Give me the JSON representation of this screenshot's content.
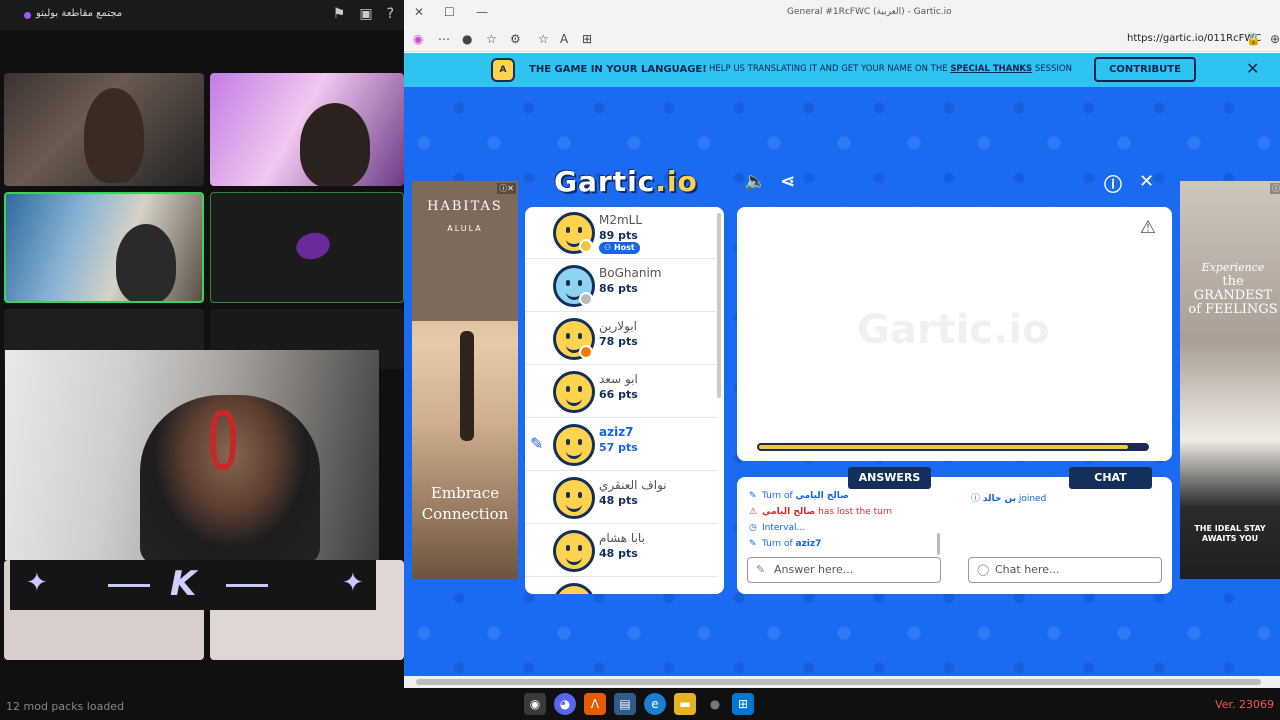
{
  "left_panel": {
    "room_title": "مجتمع مقاطعة بوليتو",
    "toolbar_icons": [
      "flag-icon",
      "screen-share-icon",
      "help-icon"
    ],
    "overlay_logo": "K",
    "mod_status": "12 mod packs loaded"
  },
  "browser": {
    "tab_title": "General #1RcFWC (العربية) - Gartic.io",
    "url": "https://gartic.io/011RcFWC"
  },
  "banner": {
    "badge": "A",
    "headline": "THE GAME IN YOUR LANGUAGE!",
    "text_before": "HELP US TRANSLATING IT AND GET YOUR NAME ON THE",
    "link_text": "SPECIAL THANKS",
    "text_after": "SESSION",
    "contribute_label": "CONTRIBUTE",
    "close_label": "✕"
  },
  "ads": {
    "left": {
      "brand": "HABITAS",
      "sub": "ALULA",
      "tagline_1": "Embrace",
      "tagline_2": "Connection"
    },
    "right": {
      "line_1": "Experience",
      "line_2": "the GRANDEST",
      "line_3": "of FEELINGS",
      "bottom_1": "THE IDEAL STAY",
      "bottom_2": "AWAITS YOU"
    }
  },
  "game": {
    "logo_main": "Gartic",
    "logo_suffix": ".io",
    "players": [
      {
        "name": "M2mLL",
        "points": "89 pts",
        "host_badge": "Host",
        "status_color": "#f4c542",
        "drawing": false
      },
      {
        "name": "BoGhanim",
        "points": "86 pts",
        "status_color": "#bbbbbb",
        "drawing": false
      },
      {
        "name": "ابولارين",
        "points": "78 pts",
        "status_color": "#f57c00",
        "drawing": false
      },
      {
        "name": "ابو سعد",
        "points": "66 pts",
        "drawing": false
      },
      {
        "name": "aziz7",
        "points": "57 pts",
        "drawing": true
      },
      {
        "name": "نواف العنقري",
        "points": "48 pts",
        "drawing": false
      },
      {
        "name": "بابا هشام",
        "points": "48 pts",
        "drawing": false
      }
    ],
    "timer_fraction": 0.95,
    "answers_tab": "ANSWERS",
    "chat_tab": "CHAT",
    "answers_log": [
      {
        "prefix": "Turn of",
        "name": "صالح اليامي",
        "suffix": ""
      },
      {
        "prefix": "",
        "name": "صالح اليامي",
        "suffix": "has lost the turn"
      },
      {
        "prefix": "Interval...",
        "name": "",
        "suffix": ""
      },
      {
        "prefix": "Turn of",
        "name": "aziz7",
        "suffix": ""
      }
    ],
    "chat_log": [
      {
        "name": "بن خالد",
        "suffix": "joined"
      }
    ],
    "answer_placeholder": "Answer here...",
    "chat_placeholder": "Chat here..."
  },
  "taskbar": {
    "version": "Ver. 23069"
  }
}
